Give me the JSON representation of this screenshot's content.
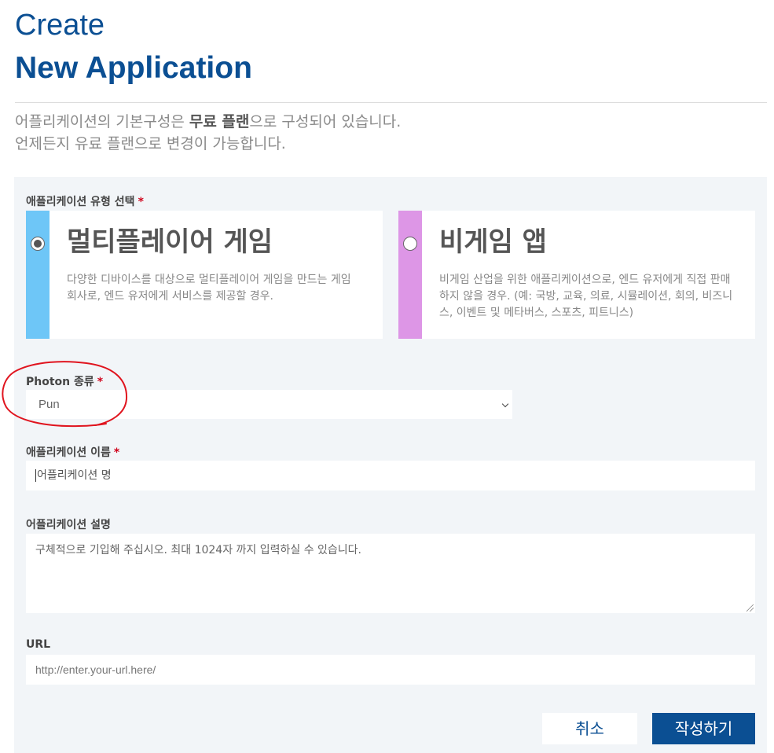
{
  "header": {
    "title_light": "Create",
    "title_bold": "New Application",
    "intro_line1_pre": "어플리케이션의 기본구성은 ",
    "intro_line1_highlight": "무료 플랜",
    "intro_line1_post": "으로 구성되어 있습니다.",
    "intro_line2": "언제든지 유료 플랜으로 변경이 가능합니다."
  },
  "form": {
    "type_label": "애플리케이션 유형 선택",
    "required_mark": "*",
    "types": [
      {
        "title": "멀티플레이어 게임",
        "description": "다양한 디바이스를 대상으로 멀티플레이어 게임을 만드는 게임 회사로, 엔드 유저에게 서비스를 제공할 경우.",
        "selected": true,
        "color": "#6ec6f7"
      },
      {
        "title": "비게임 앱",
        "description": "비게임 산업을 위한 애플리케이션으로, 엔드 유저에게 직접 판매하지 않을 경우. (예: 국방, 교육, 의료, 시뮬레이션, 회의, 비즈니스, 이벤트 및 메타버스, 스포츠, 피트니스)",
        "selected": false,
        "color": "#dd96e6"
      }
    ],
    "photon_type_label": "Photon 종류",
    "photon_type_value": "Pun",
    "app_name_label": "애플리케이션 이름",
    "app_name_placeholder": "어플리케이션 명",
    "app_desc_label": "어플리케이션 설명",
    "app_desc_placeholder": "구체적으로 기입해 주십시오. 최대 1024자 까지 입력하실 수 있습니다.",
    "url_label": "URL",
    "url_placeholder": "http://enter.your-url.here/",
    "cancel_label": "취소",
    "submit_label": "작성하기"
  },
  "colors": {
    "brand": "#0b4f93",
    "panel_bg": "#f2f5f8",
    "required": "#d0021b",
    "annotation": "#e0141e"
  }
}
